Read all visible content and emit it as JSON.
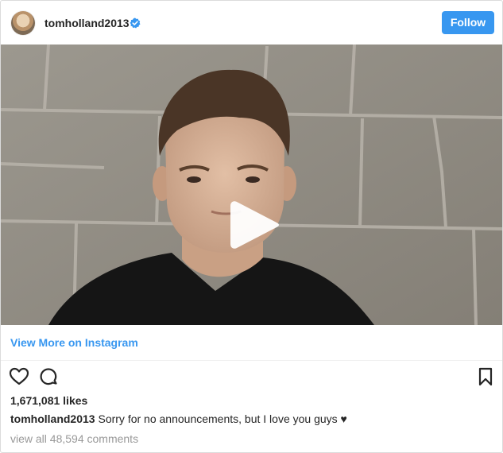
{
  "post": {
    "username": "tomholland2013",
    "follow_label": "Follow",
    "view_more_label": "View More on Instagram",
    "likes": "1,671,081 likes",
    "caption_user": "tomholland2013",
    "caption_text": "Sorry for no announcements, but I love you guys ♥",
    "comments_link": "view all 48,594 comments"
  },
  "icons": {
    "verified": "verified-badge-icon",
    "play": "play-icon",
    "like": "heart-icon",
    "comment": "comment-icon",
    "save": "bookmark-icon"
  },
  "colors": {
    "accent": "#3897f0",
    "text": "#262626",
    "muted": "#999999",
    "border": "#dbdbdb"
  }
}
